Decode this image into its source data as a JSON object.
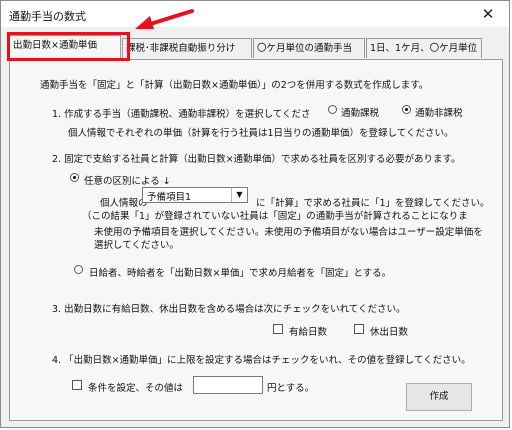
{
  "window": {
    "title": "通勤手当の数式",
    "close_symbol": "✕"
  },
  "tabs": [
    {
      "label": "出勤日数×通勤単価"
    },
    {
      "label": "課税･非課税自動振り分け"
    },
    {
      "label": "〇ケ月単位の通勤手当"
    },
    {
      "label": "1日、1ケ月、〇ケ月単位"
    }
  ],
  "annotation": {
    "color": "#e8101a"
  },
  "content": {
    "intro": "通勤手当を「固定」と「計算（出勤日数×通勤単価）」の2つを併用する数式を作成します。",
    "section1": {
      "heading": "1. 作成する手当（通勤課税、通勤非課税）を選択してくださ",
      "radio_taxable": "通勤課税",
      "radio_nontaxable": "通勤非課税",
      "note": "個人情報でそれぞれの単価（計算を行う社員は1日当りの通勤単価）を登録してください。"
    },
    "section2": {
      "heading": "2. 固定で支給する社員と計算（出勤日数×通勤単価）で求める社員を区別する必要があります。",
      "radio_optional": "任意の区別による  ↓",
      "personal_info_label": "個人情報の",
      "select_value": "予備項目1",
      "after_select": "に「計算」で求める社員に「1」を登録してください。",
      "note1": "（この結果「1」が登録されていない社員は「固定」の通勤手当が計算されることになりま",
      "note2": "未使用の予備項目を選択してください。未使用の予備項目がない場合はユーザー設定単価を",
      "note3": "選択してください。",
      "radio_daily": "日給者、時給者を「出勤日数×単価」で求め月給者を「固定」とする。"
    },
    "section3": {
      "heading": "3. 出勤日数に有給日数、休出日数を含める場合は次にチェックをいれてください。",
      "check_paid": "有給日数",
      "check_holiday": "休出日数"
    },
    "section4": {
      "heading": "4. 「出勤日数×通勤単価」に上限を設定する場合はチェックをいれ、その値を登録してください。",
      "check_limit": "条件を設定、その値は",
      "input_value": "",
      "suffix": "円とする。"
    },
    "create_button": "作成"
  }
}
